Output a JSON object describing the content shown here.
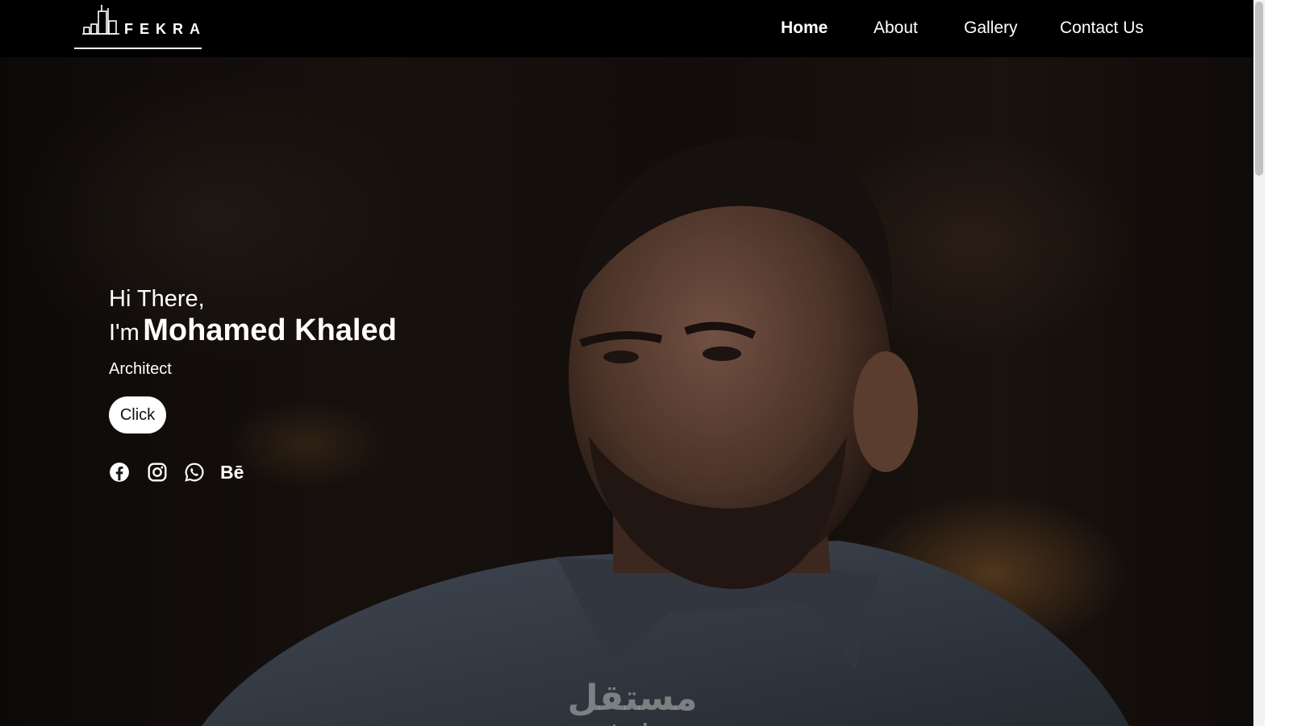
{
  "brand": {
    "name": "FEKRA",
    "logo_icon": "buildings-icon"
  },
  "nav": {
    "items": [
      {
        "label": "Home",
        "active": true
      },
      {
        "label": "About",
        "active": false
      },
      {
        "label": "Gallery",
        "active": false
      },
      {
        "label": "Contact Us",
        "active": false
      }
    ]
  },
  "hero": {
    "greeting": "Hi There,",
    "im_prefix": "I'm",
    "name": "Mohamed Khaled",
    "role": "Architect",
    "cta_label": "Click",
    "socials": [
      {
        "icon": "facebook-icon"
      },
      {
        "icon": "instagram-icon"
      },
      {
        "icon": "whatsapp-icon"
      },
      {
        "icon": "behance-icon",
        "text": "Bē"
      }
    ]
  },
  "watermark": {
    "arabic": "مستقل",
    "latin": "mostaql.com"
  }
}
